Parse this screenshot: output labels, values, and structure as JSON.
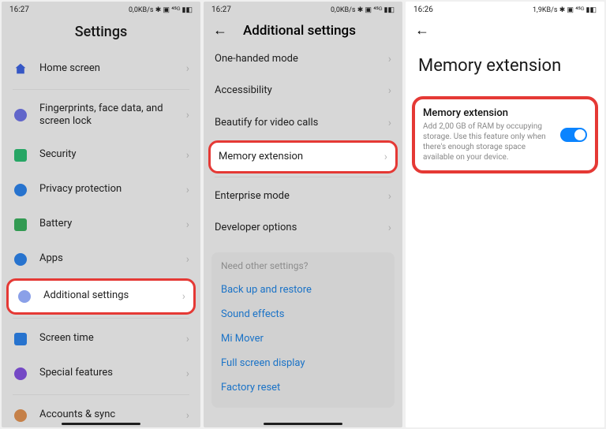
{
  "screen1": {
    "status": {
      "time": "16:27",
      "right": "0,0KB/s ✱ ▣ ⁴⁵ᴳ ▮◧"
    },
    "title": "Settings",
    "items": [
      {
        "label": "Home screen",
        "icon": "home"
      }
    ],
    "group2": [
      {
        "label": "Fingerprints, face data, and screen lock",
        "icon": "finger"
      },
      {
        "label": "Security",
        "icon": "sec"
      },
      {
        "label": "Privacy protection",
        "icon": "priv"
      },
      {
        "label": "Battery",
        "icon": "bat"
      },
      {
        "label": "Apps",
        "icon": "apps"
      }
    ],
    "highlighted": {
      "label": "Additional settings",
      "icon": "addl"
    },
    "group3": [
      {
        "label": "Screen time",
        "icon": "time"
      },
      {
        "label": "Special features",
        "icon": "spec"
      }
    ],
    "group4": [
      {
        "label": "Accounts & sync",
        "icon": "acct"
      }
    ]
  },
  "screen2": {
    "status": {
      "time": "16:27",
      "right": "0,0KB/s ✱ ▣ ⁴⁵ᴳ ▮◧"
    },
    "title": "Additional settings",
    "groupA": [
      {
        "label": "One-handed mode"
      },
      {
        "label": "Accessibility"
      },
      {
        "label": "Beautify for video calls"
      }
    ],
    "highlighted": {
      "label": "Memory extension"
    },
    "groupB": [
      {
        "label": "Enterprise mode"
      },
      {
        "label": "Developer options"
      }
    ],
    "card": {
      "hint": "Need other settings?",
      "links": [
        "Back up and restore",
        "Sound effects",
        "Mi Mover",
        "Full screen display",
        "Factory reset"
      ]
    }
  },
  "screen3": {
    "status": {
      "time": "16:26",
      "right": "1,9KB/s ✱ ▣ ⁴⁵ᴳ ▮◧"
    },
    "title": "Memory extension",
    "card": {
      "title": "Memory extension",
      "desc": "Add 2,00 GB of RAM by occupying storage. Use this feature only when there's enough storage space available on your device.",
      "toggle": true
    }
  }
}
